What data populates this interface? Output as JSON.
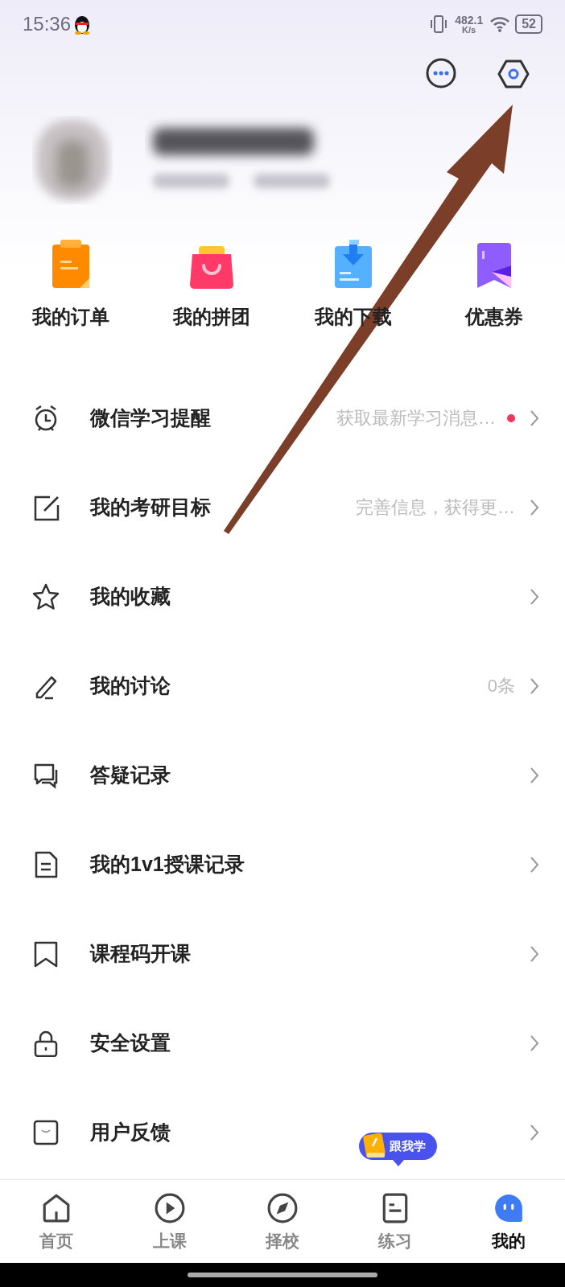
{
  "status_bar": {
    "time": "15:36",
    "net_speed": "482.1",
    "net_unit": "K/s",
    "battery": "52"
  },
  "shortcuts": [
    {
      "label": "我的订单"
    },
    {
      "label": "我的拼团"
    },
    {
      "label": "我的下载"
    },
    {
      "label": "优惠券"
    }
  ],
  "menu": [
    {
      "label": "微信学习提醒",
      "hint": "获取最新学习消息…",
      "dot": true
    },
    {
      "label": "我的考研目标",
      "hint": "完善信息，获得更…",
      "dot": false
    },
    {
      "label": "我的收藏",
      "dot": false
    },
    {
      "label": "我的讨论",
      "hint": "0条",
      "dot": false
    },
    {
      "label": "答疑记录",
      "dot": false
    },
    {
      "label": "我的1v1授课记录",
      "dot": false
    },
    {
      "label": "课程码开课",
      "dot": false
    },
    {
      "label": "安全设置",
      "dot": false
    },
    {
      "label": "用户反馈",
      "dot": false
    }
  ],
  "follow_bubble": "跟我学",
  "tab_bar": [
    {
      "label": "首页",
      "selected": false
    },
    {
      "label": "上课",
      "selected": false
    },
    {
      "label": "择校",
      "selected": false
    },
    {
      "label": "练习",
      "selected": false
    },
    {
      "label": "我的",
      "selected": true
    }
  ]
}
